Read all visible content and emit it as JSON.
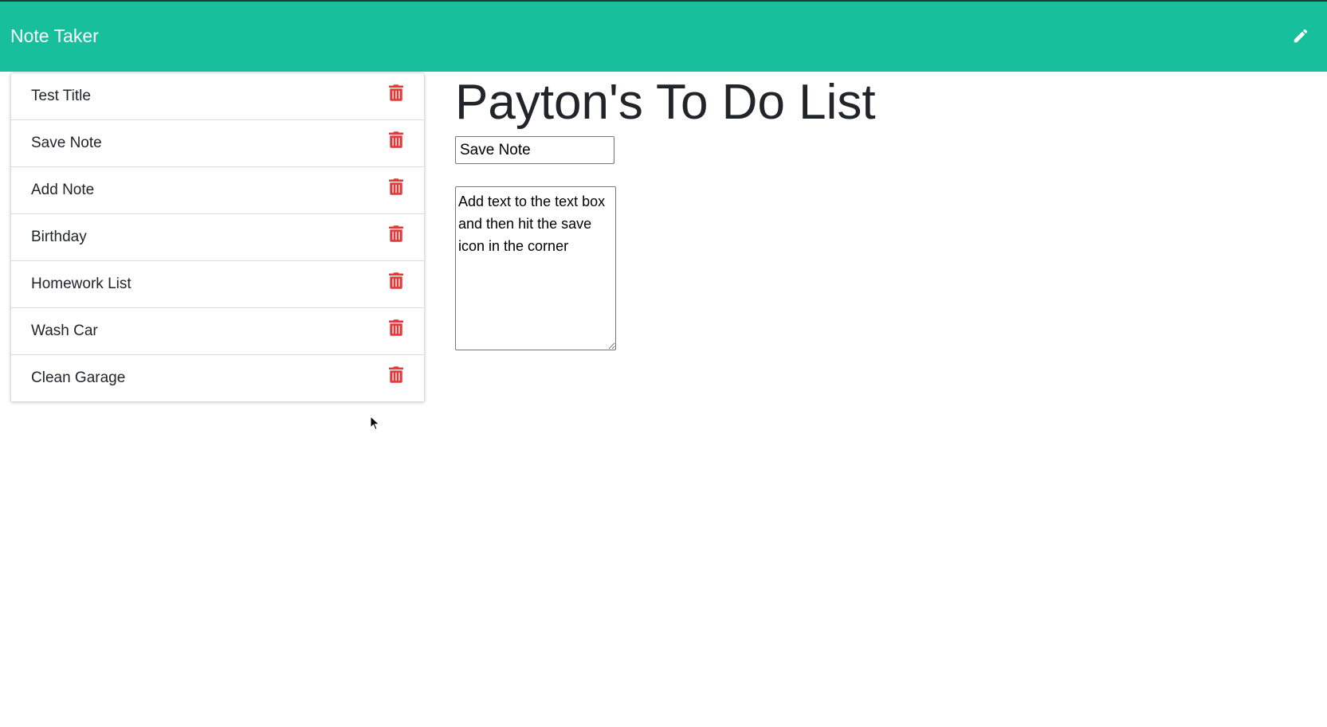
{
  "colors": {
    "brand": "#17bf9d",
    "delete": "#e03a3a"
  },
  "navbar": {
    "brand_label": "Note Taker",
    "new_note_icon": "pencil-icon"
  },
  "notes": [
    {
      "title": "Test Title"
    },
    {
      "title": "Save Note"
    },
    {
      "title": "Add Note"
    },
    {
      "title": "Birthday"
    },
    {
      "title": "Homework List"
    },
    {
      "title": "Wash Car"
    },
    {
      "title": "Clean Garage"
    }
  ],
  "delete_icon": "trash-icon",
  "main": {
    "heading": "Payton's To Do List",
    "note_title_value": "Save Note",
    "note_text_value": "Add text to the text box and then hit the save icon in the corner"
  }
}
